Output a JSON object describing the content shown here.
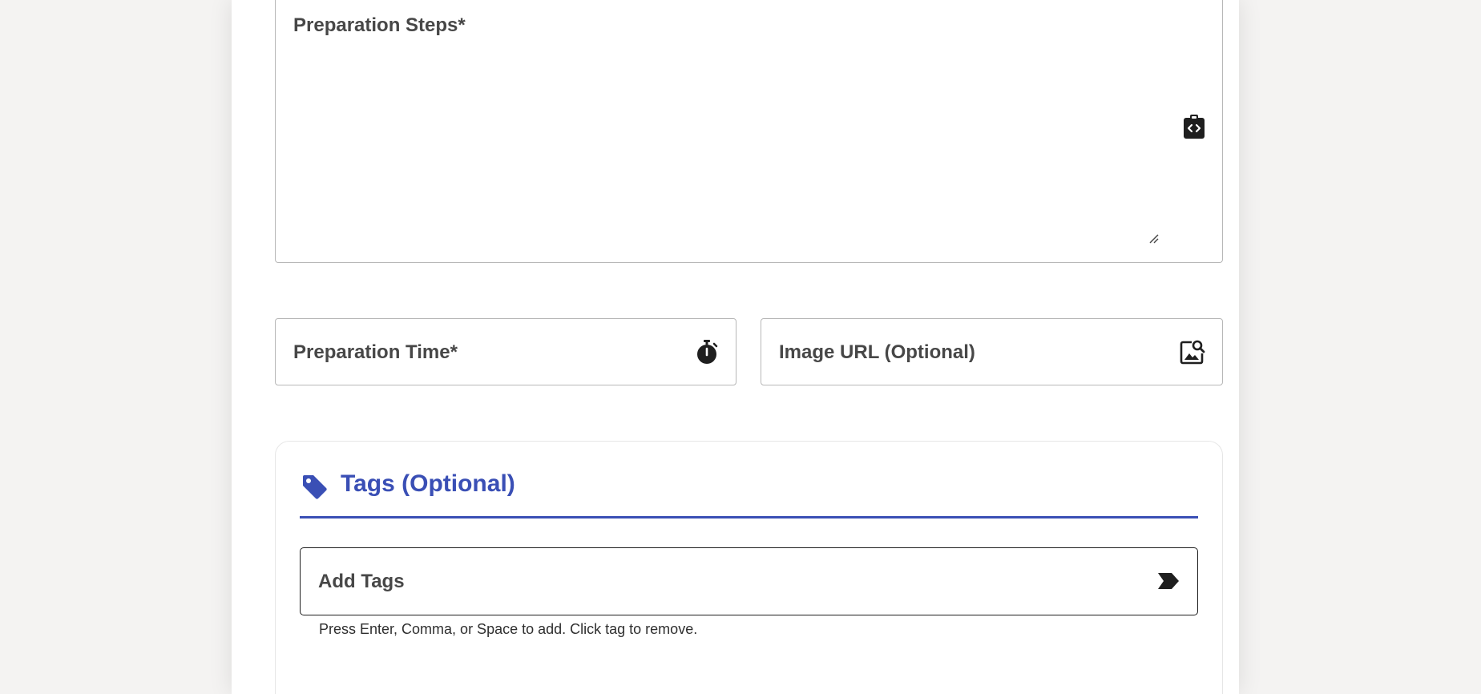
{
  "form": {
    "preparation_steps": {
      "label": "Preparation Steps*",
      "value": "",
      "icon": "code-clipboard-icon"
    },
    "preparation_time": {
      "label": "Preparation Time*",
      "value": "",
      "icon": "stopwatch-icon"
    },
    "image_url": {
      "label": "Image URL (Optional)",
      "value": "",
      "icon": "image-search-icon"
    }
  },
  "tags": {
    "title": "Tags (Optional)",
    "header_icon": "tag-icon",
    "input_label": "Add Tags",
    "input_icon": "label-arrow-icon",
    "help_text": "Press Enter, Comma, or Space to add. Click tag to remove."
  },
  "colors": {
    "accent": "#3a4fb5",
    "page_background": "#f4f3f2",
    "card_background": "#ffffff",
    "border": "#b7b7b7"
  }
}
